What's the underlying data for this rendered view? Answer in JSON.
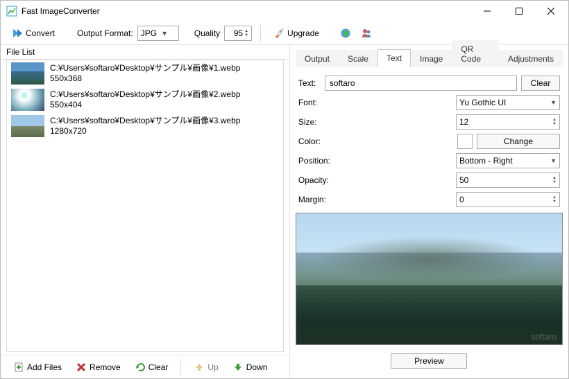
{
  "window": {
    "title": "Fast ImageConverter"
  },
  "toolbar": {
    "convert": "Convert",
    "output_format_label": "Output Format:",
    "output_format_value": "JPG",
    "quality_label": "Quality",
    "quality_value": "95",
    "upgrade": "Upgrade"
  },
  "file_list": {
    "header": "File List",
    "items": [
      {
        "path": "C:¥Users¥softaro¥Desktop¥サンプル¥画像¥1.webp",
        "dims": "550x368"
      },
      {
        "path": "C:¥Users¥softaro¥Desktop¥サンプル¥画像¥2.webp",
        "dims": "550x404"
      },
      {
        "path": "C:¥Users¥softaro¥Desktop¥サンプル¥画像¥3.webp",
        "dims": "1280x720"
      }
    ]
  },
  "bottom": {
    "add_files": "Add Files",
    "remove": "Remove",
    "clear": "Clear",
    "up": "Up",
    "down": "Down"
  },
  "tabs": {
    "output": "Output",
    "scale": "Scale",
    "text": "Text",
    "image": "Image",
    "qr_code": "QR Code",
    "adjustments": "Adjustments"
  },
  "text_panel": {
    "text_label": "Text:",
    "text_value": "softaro",
    "clear": "Clear",
    "font_label": "Font:",
    "font_value": "Yu Gothic UI",
    "size_label": "Size:",
    "size_value": "12",
    "color_label": "Color:",
    "change": "Change",
    "position_label": "Position:",
    "position_value": "Bottom - Right",
    "opacity_label": "Opacity:",
    "opacity_value": "50",
    "margin_label": "Margin:",
    "margin_value": "0"
  },
  "preview": {
    "watermark": "softaro",
    "button": "Preview"
  }
}
